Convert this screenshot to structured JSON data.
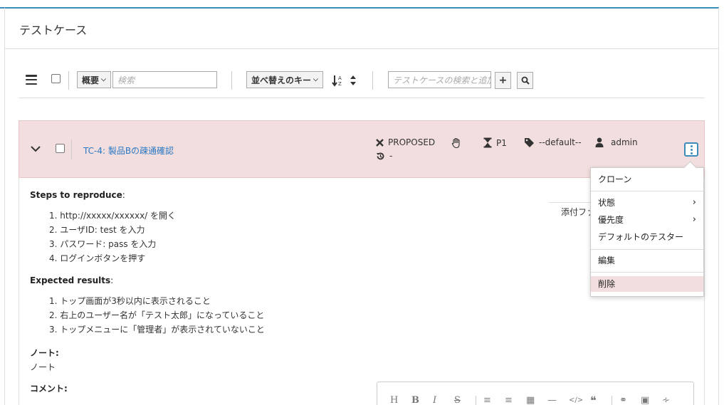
{
  "page": {
    "title": "テストケース"
  },
  "toolbar": {
    "filter_select": "概要",
    "filter_placeholder": "検索",
    "sort_select": "並べ替えのキー",
    "search_add_placeholder": "テストケースの検索と追加",
    "add_label": "+"
  },
  "testcase": {
    "title": "TC-4: 製品Bの疎通確認",
    "status": "PROPOSED",
    "history": "-",
    "priority": "P1",
    "tag": "--default--",
    "assignee": "admin"
  },
  "details": {
    "steps_heading": "Steps to reproduce",
    "steps": [
      "1. http://xxxxx/xxxxxx/ を開く",
      "2. ユーザID: test を入力",
      "3. パスワード: pass を入力",
      "4. ログインボタンを押す"
    ],
    "expected_heading": "Expected results",
    "expected": [
      "1. トップ画面が3秒以内に表示されること",
      "2. 右上のユーザー名が「テスト太郎」になっていること",
      "3. トップメニューに「管理者」が表示されていないこと"
    ],
    "note_heading": "ノート:",
    "note_text": "ノート",
    "comment_heading": "コメント:",
    "attachments_label": "添付ファイル"
  },
  "editor_tools": [
    "H",
    "B",
    "I",
    "S",
    "ordered-list",
    "bullet-list",
    "table",
    "hr",
    "code",
    "quote",
    "link",
    "image",
    "attach"
  ],
  "menu": {
    "items": [
      {
        "label": "クローン"
      },
      {
        "label": "状態",
        "submenu": true
      },
      {
        "label": "優先度",
        "submenu": true
      },
      {
        "label": "デフォルトのテスター"
      },
      {
        "label": "編集"
      },
      {
        "label": "削除"
      }
    ]
  },
  "colors": {
    "accent": "#3c8dbc",
    "row_bg": "#f2dede",
    "link": "#2a78c4"
  }
}
